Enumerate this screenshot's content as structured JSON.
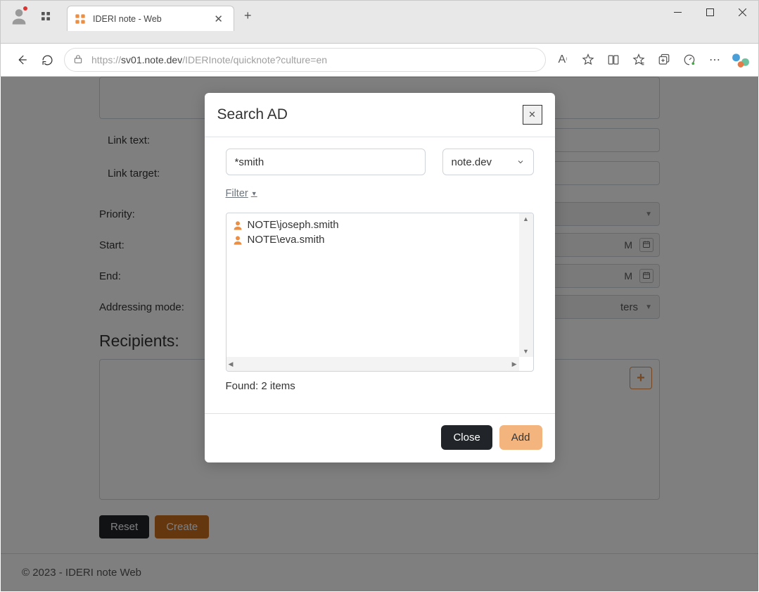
{
  "browser": {
    "tab_title": "IDERI note - Web",
    "url_prefix": "https://",
    "url_host": "sv01.note.dev",
    "url_path": "/IDERInote/quicknote?culture=en"
  },
  "form": {
    "link_text_label": "Link text:",
    "link_target_label": "Link target:",
    "priority_label": "Priority:",
    "start_label": "Start:",
    "end_label": "End:",
    "addressing_label": "Addressing mode:",
    "time_suffix": "M",
    "addressing_value_tail": "ters",
    "recipients_heading": "Recipients:",
    "reset_label": "Reset",
    "create_label": "Create"
  },
  "footer": {
    "text": "© 2023 - IDERI note Web"
  },
  "modal": {
    "title": "Search AD",
    "search_value": "*smith",
    "domain_value": "note.dev",
    "filter_label": "Filter",
    "found_text": "Found: 2 items",
    "close_label": "Close",
    "add_label": "Add",
    "results": [
      "NOTE\\joseph.smith",
      "NOTE\\eva.smith"
    ]
  }
}
